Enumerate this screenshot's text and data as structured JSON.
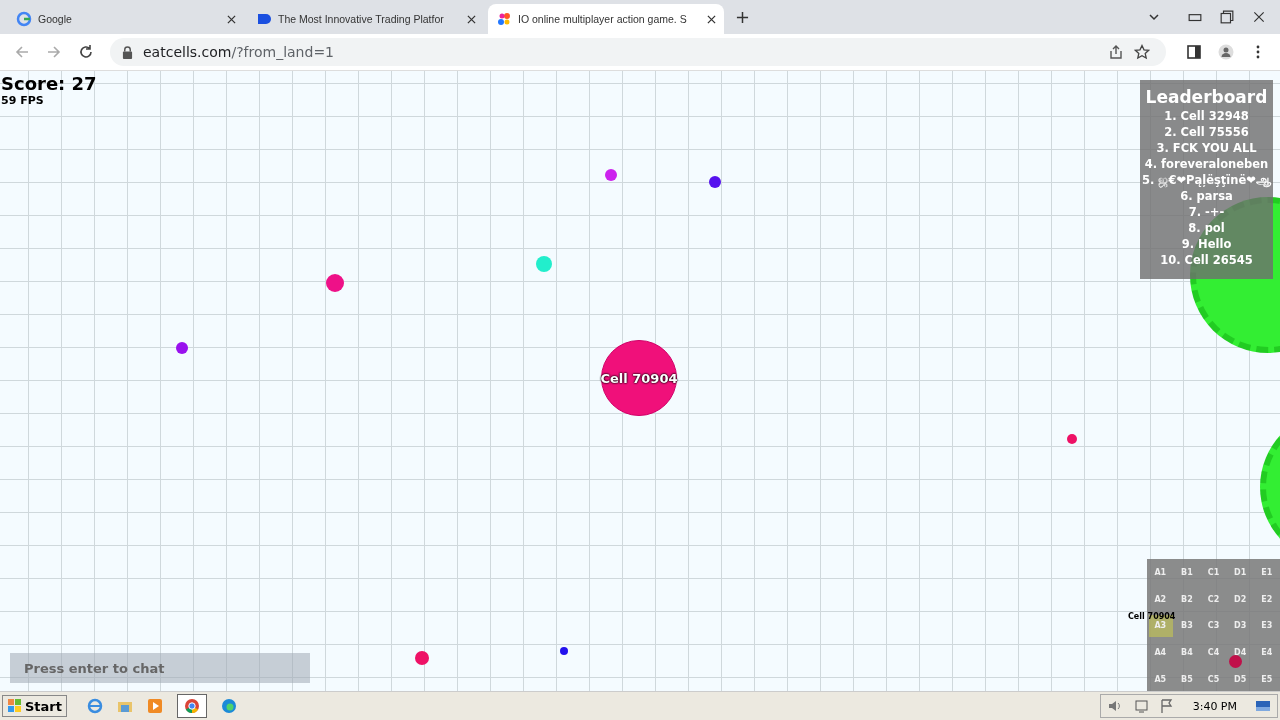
{
  "browser": {
    "tabs": [
      {
        "title": "Google",
        "selected": false
      },
      {
        "title": "The Most Innovative Trading Platfor",
        "selected": false
      },
      {
        "title": "IO online multiplayer action game. S",
        "selected": true
      }
    ],
    "address": {
      "domain": "eatcells.com",
      "path": "/?from_land=1"
    }
  },
  "game": {
    "score": "Score: 27",
    "fps": "59 FPS",
    "player": "Cell 70904",
    "leaderboard": {
      "title": "Leaderboard",
      "entries": [
        "1. Cell 32948",
        "2. Cell 75556",
        "3. FCK YOU ALL",
        "4. foreveraloneben",
        "5. ஜ€❤Pąļëşţïnë❤ஆ",
        "6. parsa",
        "7. -+-",
        "8. pol",
        "9. Hello",
        "10. Cell 26545"
      ]
    },
    "minimap": {
      "cells": [
        "A1",
        "B1",
        "C1",
        "D1",
        "E1",
        "A2",
        "B2",
        "C2",
        "D2",
        "E2",
        "A3",
        "B3",
        "C3",
        "D3",
        "E3",
        "A4",
        "B4",
        "C4",
        "D4",
        "E4",
        "A5",
        "B5",
        "C5",
        "D5",
        "E5"
      ],
      "player_label": "Cell 70904"
    },
    "chat": {
      "placeholder": "Press enter to chat"
    }
  },
  "taskbar": {
    "start": "Start",
    "clock": "3:40 PM"
  }
}
